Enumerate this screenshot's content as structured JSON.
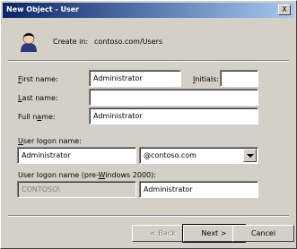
{
  "window": {
    "title": "New Object - User",
    "close_label": "X"
  },
  "header": {
    "create_in_label": "Create in:",
    "create_in_value": "contoso.com/Users"
  },
  "form": {
    "first_name": {
      "label": "First name:",
      "value": "Administrator"
    },
    "initials": {
      "label": "Initials:",
      "value": ""
    },
    "last_name": {
      "label": "Last name:",
      "value": ""
    },
    "full_name": {
      "label": "Full name:",
      "value": "Administrator"
    },
    "logon_name": {
      "label": "User logon name:",
      "value": "Administrator",
      "domain": "@contoso.com"
    },
    "pre2000": {
      "label": "User logon name (pre-Windows 2000):",
      "domain": "CONTOSO\\",
      "value": "Administrator"
    }
  },
  "buttons": {
    "back": "< Back",
    "next": "Next >",
    "cancel": "Cancel"
  }
}
